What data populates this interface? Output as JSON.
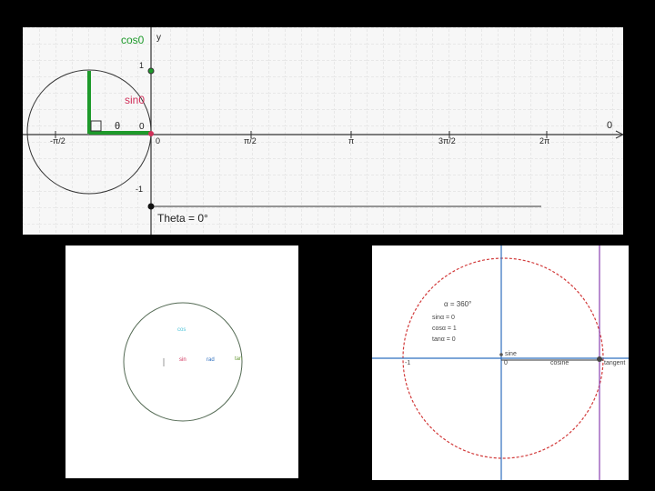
{
  "top": {
    "cos_label": "cos0",
    "y_axis_label": "y",
    "sin_label": "sin0",
    "theta_label": "θ",
    "origin_label": "0",
    "theta_axis_label": "0",
    "y_ticks": [
      "1",
      "-1"
    ],
    "x_ticks": [
      "-π/2",
      "0",
      "π/2",
      "π",
      "3π/2",
      "2π"
    ],
    "theta_readout": "Theta = 0°"
  },
  "bottom_left": {
    "cos_tag": "cos",
    "sin_tag": "sin",
    "rad_tag": "rad",
    "tan_tag": "tan"
  },
  "bottom_right": {
    "alpha": "α = 360°",
    "sin": "sinα = 0",
    "cos": "cosα = 1",
    "tan": "tanα = 0",
    "neg_one": "-1",
    "zero": "0",
    "cosine_label": "cosine",
    "tangent_label": "tangent",
    "sine_label": "sine"
  },
  "colors": {
    "green": "#1e9a2b",
    "red": "#d0305a",
    "blue": "#2f6fbf",
    "purple": "#8a3fb0"
  }
}
